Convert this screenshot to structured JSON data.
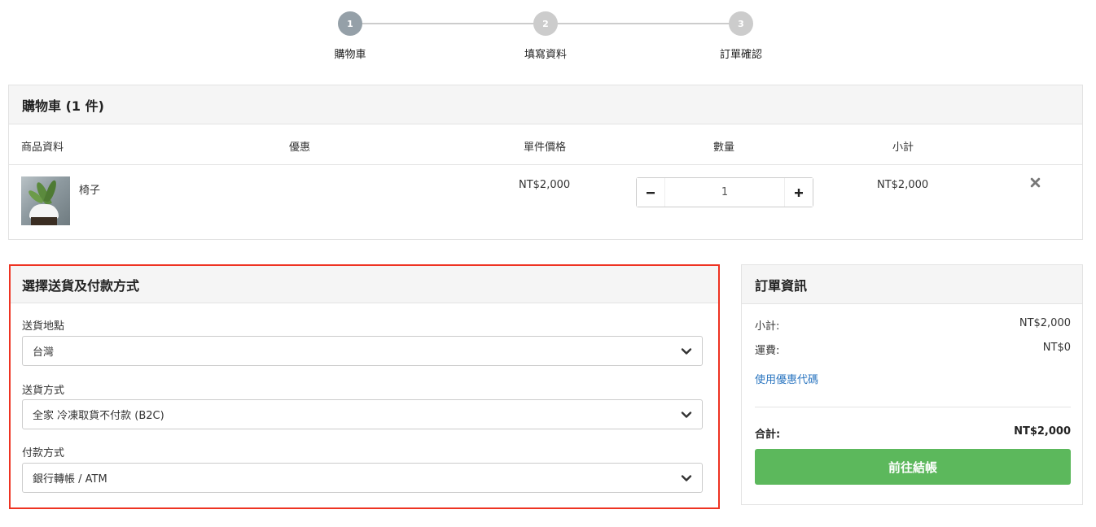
{
  "steps": [
    {
      "number": "1",
      "label": "購物車"
    },
    {
      "number": "2",
      "label": "填寫資料"
    },
    {
      "number": "3",
      "label": "訂單確認"
    }
  ],
  "cart": {
    "title": "購物車 (1 件)",
    "columns": {
      "product": "商品資料",
      "discount": "優惠",
      "unit_price": "單件價格",
      "quantity": "數量",
      "subtotal": "小計"
    },
    "item": {
      "name": "椅子",
      "unit_price": "NT$2,000",
      "quantity": "1",
      "subtotal": "NT$2,000",
      "thumbnail_icon": "chair-product-image"
    }
  },
  "shipping": {
    "title": "選擇送貨及付款方式",
    "location_label": "送貨地點",
    "location_value": "台灣",
    "method_label": "送貨方式",
    "method_value": "全家 冷凍取貨不付款 (B2C)",
    "payment_label": "付款方式",
    "payment_value": "銀行轉帳 / ATM"
  },
  "order": {
    "title": "訂單資訊",
    "subtotal_label": "小計:",
    "subtotal_value": "NT$2,000",
    "shipping_label": "運費:",
    "shipping_value": "NT$0",
    "coupon_link": "使用優惠代碼",
    "total_label": "合計:",
    "total_value": "NT$2,000",
    "checkout_label": "前往結帳"
  },
  "colors": {
    "highlight_border": "#ee3322",
    "checkout_green": "#5cb85c",
    "link_blue": "#2a75c0",
    "step_active": "#95a0a8",
    "step_inactive": "#cccccc"
  }
}
